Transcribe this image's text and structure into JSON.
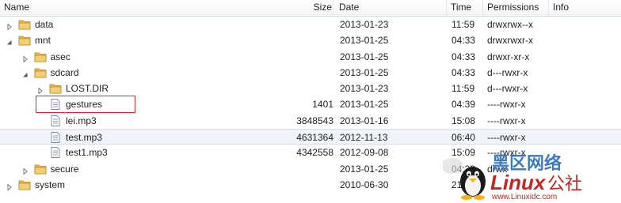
{
  "columns": {
    "name": "Name",
    "size": "Size",
    "date": "Date",
    "time": "Time",
    "permissions": "Permissions",
    "info": "Info"
  },
  "rows": [
    {
      "name": "data",
      "type": "folder",
      "expanded": false,
      "depth": 0,
      "size": "",
      "date": "2013-01-23",
      "time": "11:59",
      "permissions": "drwxrwx--x"
    },
    {
      "name": "mnt",
      "type": "folder",
      "expanded": true,
      "depth": 0,
      "size": "",
      "date": "2013-01-25",
      "time": "04:33",
      "permissions": "drwxrwxr-x"
    },
    {
      "name": "asec",
      "type": "folder",
      "expanded": false,
      "depth": 1,
      "size": "",
      "date": "2013-01-25",
      "time": "04:33",
      "permissions": "drwxr-xr-x"
    },
    {
      "name": "sdcard",
      "type": "folder",
      "expanded": true,
      "depth": 1,
      "size": "",
      "date": "2013-01-25",
      "time": "04:33",
      "permissions": "d---rwxr-x"
    },
    {
      "name": "LOST.DIR",
      "type": "folder",
      "expanded": false,
      "depth": 2,
      "size": "",
      "date": "2013-01-23",
      "time": "11:59",
      "permissions": "d---rwxr-x"
    },
    {
      "name": "gestures",
      "type": "file",
      "depth": 2,
      "size": "1401",
      "date": "2013-01-25",
      "time": "04:39",
      "permissions": "----rwxr-x"
    },
    {
      "name": "lei.mp3",
      "type": "file",
      "depth": 2,
      "size": "3848543",
      "date": "2013-01-16",
      "time": "15:08",
      "permissions": "----rwxr-x"
    },
    {
      "name": "test.mp3",
      "type": "file",
      "depth": 2,
      "size": "4631364",
      "date": "2012-11-13",
      "time": "06:40",
      "permissions": "----rwxr-x",
      "selected": true
    },
    {
      "name": "test1.mp3",
      "type": "file",
      "depth": 2,
      "size": "4342558",
      "date": "2012-09-08",
      "time": "15:09",
      "permissions": "----rwxr-x"
    },
    {
      "name": "secure",
      "type": "folder",
      "expanded": false,
      "depth": 1,
      "size": "",
      "date": "2013-01-25",
      "time": "04:33",
      "permissions": "drwx"
    },
    {
      "name": "system",
      "type": "folder",
      "expanded": false,
      "depth": 0,
      "size": "",
      "date": "2010-06-30",
      "time": "21:06",
      "permissions": ""
    }
  ],
  "watermark": {
    "cn": "黑区网络",
    "brand": "Linux",
    "brand_cn": "公社",
    "url": "www.Linuxidc.com"
  },
  "colors": {
    "folder": "#e8b84a",
    "highlight_box": "#d22a2a",
    "watermark_red": "#c8231f",
    "watermark_blue": "#1d63b6"
  }
}
